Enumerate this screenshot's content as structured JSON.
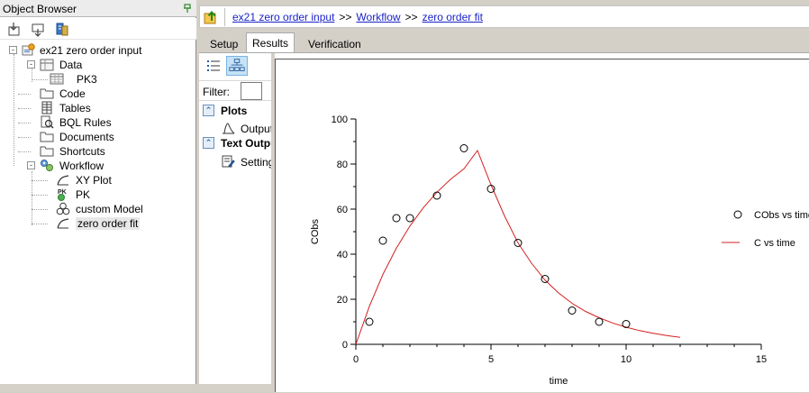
{
  "object_browser": {
    "title": "Object Browser",
    "tree": [
      {
        "id": "root",
        "label": "ex21 zero order input",
        "icon": "project-icon",
        "expander": "-"
      },
      {
        "id": "data",
        "label": "Data",
        "icon": "data-folder-icon",
        "expander": "-"
      },
      {
        "id": "pk3",
        "label": "PK3",
        "icon": "table-icon"
      },
      {
        "id": "code",
        "label": "Code",
        "icon": "folder-icon"
      },
      {
        "id": "tables",
        "label": "Tables",
        "icon": "tables-icon"
      },
      {
        "id": "bql",
        "label": "BQL Rules",
        "icon": "bql-icon"
      },
      {
        "id": "documents",
        "label": "Documents",
        "icon": "folder-icon"
      },
      {
        "id": "shortcuts",
        "label": "Shortcuts",
        "icon": "folder-icon"
      },
      {
        "id": "workflow",
        "label": "Workflow",
        "icon": "workflow-icon",
        "expander": "-"
      },
      {
        "id": "xyplot",
        "label": "XY Plot",
        "icon": "xy-plot-icon"
      },
      {
        "id": "pk",
        "label": "PK",
        "icon": "pk-model-icon"
      },
      {
        "id": "custom",
        "label": "custom Model",
        "icon": "custom-model-icon"
      },
      {
        "id": "zerofit",
        "label": "zero order fit",
        "icon": "xy-plot-icon"
      }
    ]
  },
  "breadcrumb": {
    "items": [
      "ex21 zero order input",
      "Workflow",
      "zero order fit"
    ],
    "separator": ">>"
  },
  "tabs": [
    {
      "label": "Setup",
      "active": false
    },
    {
      "label": "Results",
      "active": true
    },
    {
      "label": "Verification",
      "active": false
    }
  ],
  "results": {
    "filter_label": "Filter:",
    "filter_value": "",
    "sections": [
      {
        "label": "Plots",
        "items": [
          "Output"
        ]
      },
      {
        "label": "Text Output",
        "items": [
          "Settings"
        ]
      }
    ]
  },
  "chart_data": {
    "type": "scatter",
    "xlabel": "time",
    "ylabel": "CObs",
    "xlim": [
      0,
      15
    ],
    "ylim": [
      0,
      100
    ],
    "xticks": [
      0,
      5,
      10,
      15
    ],
    "yticks": [
      0,
      20,
      40,
      60,
      80,
      100
    ],
    "grid": false,
    "legend_position": "right",
    "series": [
      {
        "name": "CObs vs time",
        "kind": "scatter",
        "marker": "open-circle",
        "color": "#000000",
        "x": [
          0.5,
          1,
          1.5,
          2,
          3,
          4,
          5,
          6,
          7,
          8,
          9,
          10
        ],
        "y": [
          10,
          46,
          56,
          56,
          66,
          87,
          69,
          45,
          29,
          15,
          10,
          9
        ]
      },
      {
        "name": "C vs time",
        "kind": "line",
        "color": "#d42020",
        "x": [
          0,
          0.5,
          1,
          1.5,
          2,
          2.5,
          3,
          3.5,
          4,
          4.5,
          5,
          5.5,
          6,
          6.5,
          7,
          7.5,
          8,
          8.5,
          9,
          9.5,
          10,
          10.5,
          11,
          11.5,
          12
        ],
        "y": [
          0,
          16.9,
          31.0,
          42.7,
          52.5,
          60.7,
          67.5,
          73.2,
          77.9,
          86.0,
          70.8,
          57.0,
          45.0,
          36.0,
          28.5,
          22.8,
          18.2,
          14.6,
          11.8,
          9.5,
          7.6,
          6.1,
          4.9,
          3.9,
          3.1
        ]
      }
    ]
  }
}
